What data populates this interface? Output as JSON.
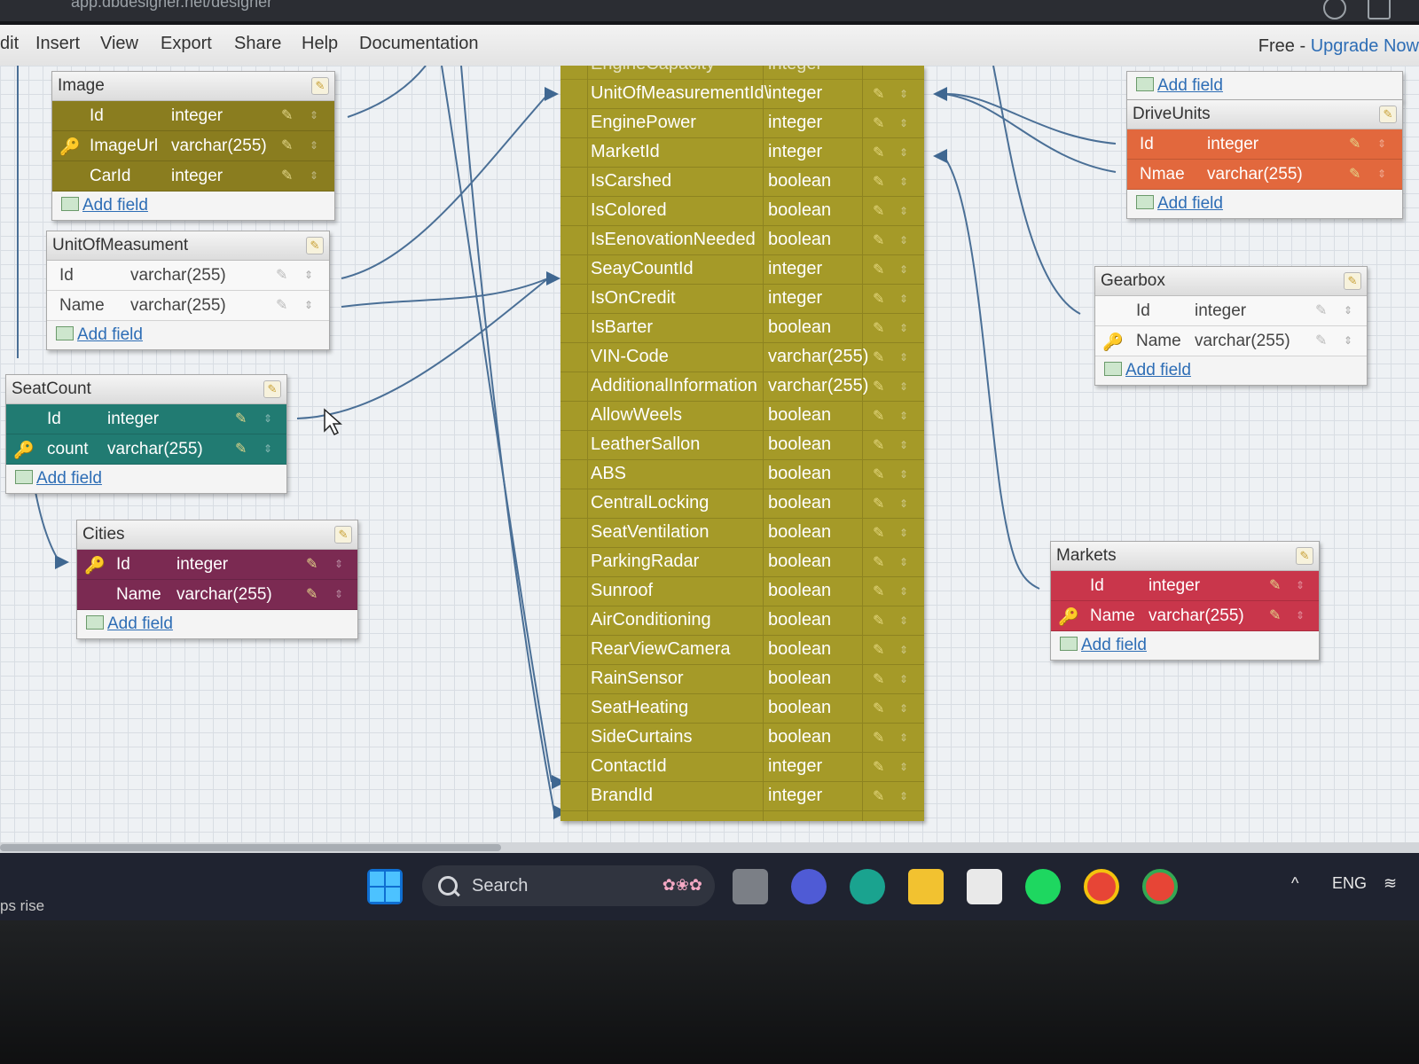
{
  "browser": {
    "url": "app.dbdesigner.net/designer"
  },
  "menu": {
    "items": [
      "dit",
      "Insert",
      "View",
      "Export",
      "Share",
      "Help",
      "Documentation"
    ],
    "plan_label": "Free - ",
    "upgrade_label": "Upgrade Now"
  },
  "add_field_label": "Add field",
  "tables": {
    "image": {
      "title": "Image",
      "rows": [
        {
          "name": "Id",
          "type": "integer"
        },
        {
          "name": "ImageUrl",
          "type": "varchar(255)"
        },
        {
          "name": "CarId",
          "type": "integer"
        }
      ]
    },
    "unit": {
      "title": "UnitOfMeasument",
      "rows": [
        {
          "name": "Id",
          "type": "varchar(255)"
        },
        {
          "name": "Name",
          "type": "varchar(255)"
        }
      ]
    },
    "seatcount": {
      "title": "SeatCount",
      "rows": [
        {
          "name": "Id",
          "type": "integer"
        },
        {
          "name": "count",
          "type": "varchar(255)"
        }
      ]
    },
    "cities": {
      "title": "Cities",
      "rows": [
        {
          "name": "Id",
          "type": "integer"
        },
        {
          "name": "Name",
          "type": "varchar(255)"
        }
      ]
    },
    "driveunits": {
      "title": "DriveUnits",
      "rows": [
        {
          "name": "Id",
          "type": "integer"
        },
        {
          "name": "Nmae",
          "type": "varchar(255)"
        }
      ]
    },
    "gearbox": {
      "title": "Gearbox",
      "rows": [
        {
          "name": "Id",
          "type": "integer"
        },
        {
          "name": "Name",
          "type": "varchar(255)"
        }
      ]
    },
    "markets": {
      "title": "Markets",
      "rows": [
        {
          "name": "Id",
          "type": "integer"
        },
        {
          "name": "Name",
          "type": "varchar(255)"
        }
      ]
    },
    "cars": {
      "rows": [
        {
          "name": "EngineCapacity",
          "type": "integer"
        },
        {
          "name": "UnitOfMeasurementId\\",
          "type": "integer"
        },
        {
          "name": "EnginePower",
          "type": "integer"
        },
        {
          "name": "MarketId",
          "type": "integer"
        },
        {
          "name": "IsCarshed",
          "type": "boolean"
        },
        {
          "name": "IsColored",
          "type": "boolean"
        },
        {
          "name": "IsEenovationNeeded",
          "type": "boolean"
        },
        {
          "name": "SeayCountId",
          "type": "integer"
        },
        {
          "name": "IsOnCredit",
          "type": "integer"
        },
        {
          "name": "IsBarter",
          "type": "boolean"
        },
        {
          "name": "VIN-Code",
          "type": "varchar(255)"
        },
        {
          "name": "AdditionalInformation",
          "type": "varchar(255)"
        },
        {
          "name": "AllowWeels",
          "type": "boolean"
        },
        {
          "name": "LeatherSallon",
          "type": "boolean"
        },
        {
          "name": "ABS",
          "type": "boolean"
        },
        {
          "name": "CentralLocking",
          "type": "boolean"
        },
        {
          "name": "SeatVentilation",
          "type": "boolean"
        },
        {
          "name": "ParkingRadar",
          "type": "boolean"
        },
        {
          "name": "Sunroof",
          "type": "boolean"
        },
        {
          "name": "AirConditioning",
          "type": "boolean"
        },
        {
          "name": "RearViewCamera",
          "type": "boolean"
        },
        {
          "name": "RainSensor",
          "type": "boolean"
        },
        {
          "name": "SeatHeating",
          "type": "boolean"
        },
        {
          "name": "SideCurtains",
          "type": "boolean"
        },
        {
          "name": "ContactId",
          "type": "integer"
        },
        {
          "name": "BrandId",
          "type": "integer"
        }
      ]
    }
  },
  "colors": {
    "image": "#8a7d1f",
    "seatcount": "#217b72",
    "cities": "#7b2a52",
    "driveunits": "#e2683d",
    "markets": "#c9364b",
    "cars": "#a59a28"
  },
  "taskbar": {
    "search_label": "Search",
    "language": "ENG",
    "weather": "ps rise",
    "icons": [
      "windows-start-icon",
      "task-view-icon",
      "meet-icon",
      "edge-icon",
      "file-explorer-icon",
      "store-icon",
      "spotify-icon",
      "chrome-icon",
      "chrome-profile-icon"
    ]
  }
}
